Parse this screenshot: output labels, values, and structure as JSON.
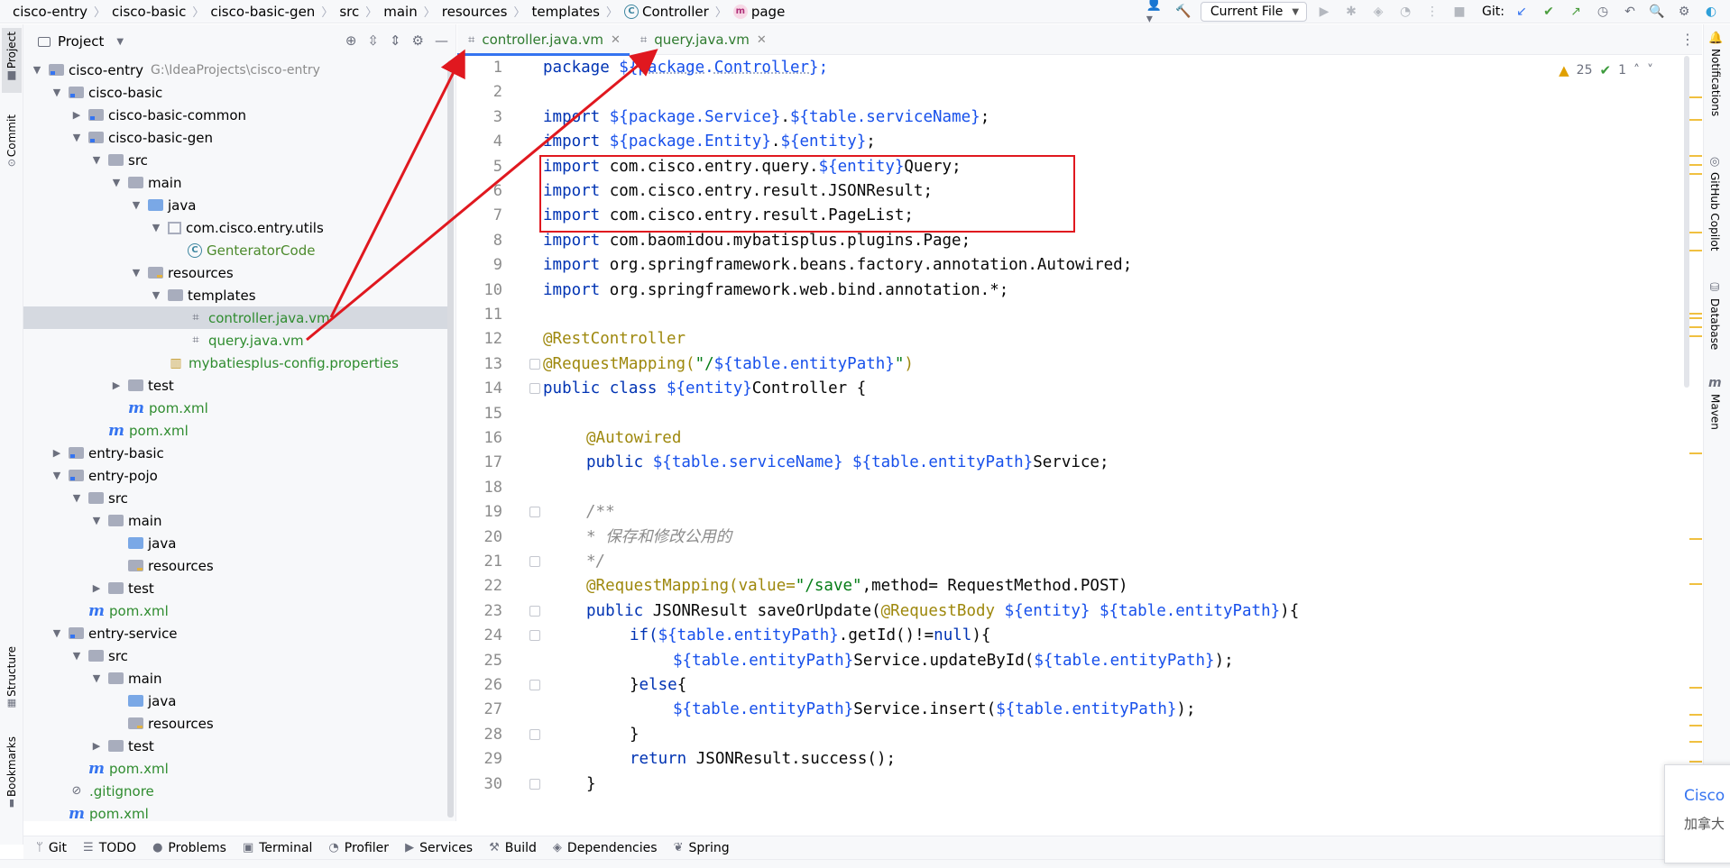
{
  "breadcrumb": {
    "items": [
      "cisco-entry",
      "cisco-basic",
      "cisco-basic-gen",
      "src",
      "main",
      "resources",
      "templates"
    ],
    "class_item": "Controller",
    "class_icon": "C",
    "file_item": "page",
    "file_icon": "m"
  },
  "toolbar": {
    "run_config": "Current File",
    "git_label": "Git:"
  },
  "left_stripe": {
    "project": "Project",
    "commit": "Commit",
    "structure": "Structure",
    "bookmarks": "Bookmarks"
  },
  "project_panel": {
    "title": "Project"
  },
  "tree": [
    {
      "label": "cisco-entry",
      "path": "G:\\IdeaProjects\\cisco-entry"
    },
    {
      "label": "cisco-basic"
    },
    {
      "label": "cisco-basic-common"
    },
    {
      "label": "cisco-basic-gen"
    },
    {
      "label": "src"
    },
    {
      "label": "main"
    },
    {
      "label": "java"
    },
    {
      "label": "com.cisco.entry.utils"
    },
    {
      "label": "GenteratorCode"
    },
    {
      "label": "resources"
    },
    {
      "label": "templates"
    },
    {
      "label": "controller.java.vm"
    },
    {
      "label": "query.java.vm"
    },
    {
      "label": "mybatiesplus-config.properties"
    },
    {
      "label": "test"
    },
    {
      "label": "pom.xml"
    },
    {
      "label": "pom.xml"
    },
    {
      "label": "entry-basic"
    },
    {
      "label": "entry-pojo"
    },
    {
      "label": "src"
    },
    {
      "label": "main"
    },
    {
      "label": "java"
    },
    {
      "label": "resources"
    },
    {
      "label": "test"
    },
    {
      "label": "pom.xml"
    },
    {
      "label": "entry-service"
    },
    {
      "label": "src"
    },
    {
      "label": "main"
    },
    {
      "label": "java"
    },
    {
      "label": "resources"
    },
    {
      "label": "test"
    },
    {
      "label": "pom.xml"
    },
    {
      "label": ".gitignore"
    },
    {
      "label": "pom.xml"
    }
  ],
  "editor_tabs": [
    {
      "label": "controller.java.vm",
      "active": true
    },
    {
      "label": "query.java.vm",
      "active": false
    }
  ],
  "inspections": {
    "warnings": "25",
    "ok": "1"
  },
  "line_numbers": [
    "1",
    "2",
    "3",
    "4",
    "5",
    "6",
    "7",
    "8",
    "9",
    "10",
    "11",
    "12",
    "13",
    "14",
    "15",
    "16",
    "17",
    "18",
    "19",
    "20",
    "21",
    "22",
    "23",
    "24",
    "25",
    "26",
    "27",
    "28",
    "29",
    "30"
  ],
  "code": {
    "l1a": "package ",
    "l1b": "${",
    "l1c": "package",
    "l1d": ".",
    "l1e": "Controller",
    "l1f": "};",
    "l3a": "import ",
    "l3b": "${package.Service}",
    "l3c": ".",
    "l3d": "${table.serviceName}",
    "l3e": ";",
    "l4a": "import ",
    "l4b": "${package.Entity}",
    "l4c": ".",
    "l4d": "${entity}",
    "l4e": ";",
    "l5a": "import ",
    "l5b": "com.cisco.entry.query.",
    "l5c": "${entity}",
    "l5d": "Query;",
    "l6a": "import ",
    "l6b": "com.cisco.entry.result.JSONResult;",
    "l7a": "import ",
    "l7b": "com.cisco.entry.result.PageList;",
    "l8a": "import ",
    "l8b": "com.baomidou.mybatisplus.plugins.Page;",
    "l9a": "import ",
    "l9b": "org.springframework.beans.factory.annotation.Autowired;",
    "l10a": "import ",
    "l10b": "org.springframework.web.bind.annotation.*;",
    "l12": "@RestController",
    "l13a": "@RequestMapping(",
    "l13b": "\"/",
    "l13c": "${table.entityPath}",
    "l13d": "\"",
    "l13e": ")",
    "l14a": "public class ",
    "l14b": "${entity}",
    "l14c": "Controller {",
    "l16": "@Autowired",
    "l17a": "public ",
    "l17b": "${table.serviceName}",
    "l17c": " ",
    "l17d": "${table.entityPath}",
    "l17e": "Service;",
    "l19": "/**",
    "l20": "* 保存和修改公用的",
    "l21": "*/",
    "l22a": "@RequestMapping(value=",
    "l22b": "\"/save\"",
    "l22c": ",method= RequestMethod.POST)",
    "l23a": "public ",
    "l23b": "JSONResult saveOrUpdate(",
    "l23c": "@RequestBody ",
    "l23d": "${entity}",
    "l23e": " ",
    "l23f": "${table.entityPath}",
    "l23g": "){",
    "l24a": "if(",
    "l24b": "${table.entityPath}",
    "l24c": ".getId()!=",
    "l24d": "null",
    "l24e": "){",
    "l25a": "${table.entityPath}",
    "l25b": "Service.updateById(",
    "l25c": "${table.entityPath}",
    "l25d": ");",
    "l26a": "}",
    "l26b": "else",
    "l26c": "{",
    "l27a": "${table.entityPath}",
    "l27b": "Service.insert(",
    "l27c": "${table.entityPath}",
    "l27d": ");",
    "l28": "}",
    "l29a": "return ",
    "l29b": "JSONResult.success();",
    "l30": "}"
  },
  "right_stripe": {
    "notifications": "Notifications",
    "copilot": "GitHub Copilot",
    "database": "Database",
    "maven": "Maven"
  },
  "tool_windows": [
    "Git",
    "TODO",
    "Problems",
    "Terminal",
    "Profiler",
    "Services",
    "Build",
    "Dependencies",
    "Spring"
  ],
  "popup": {
    "title": "Cisco",
    "subtitle": "加拿大"
  },
  "colors": {
    "keyword": "#0033b3",
    "template_var": "#1750eb",
    "annotation": "#9e880d",
    "string": "#067d17",
    "comment": "#8c8c8c",
    "highlight_box": "#e0181f",
    "vcs_added": "#2f8c2f"
  }
}
